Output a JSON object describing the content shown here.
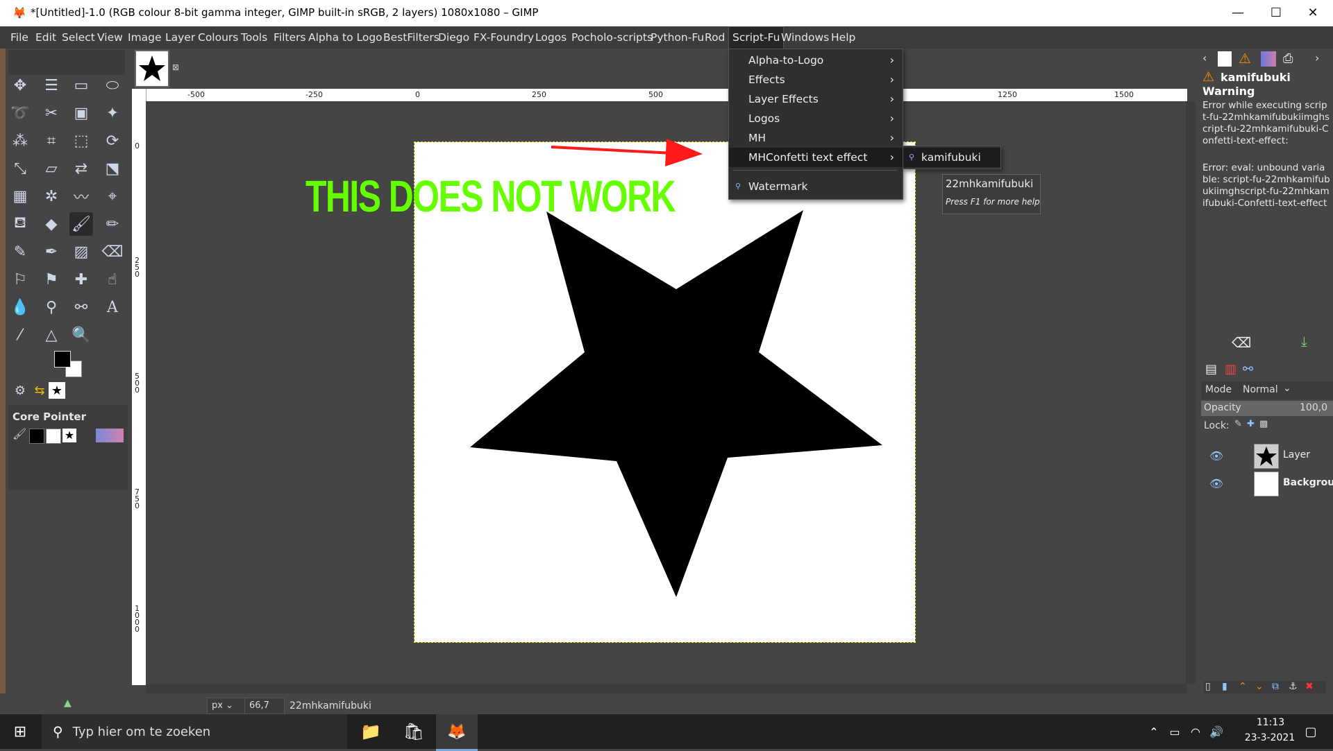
{
  "window": {
    "title": "*[Untitled]-1.0 (RGB colour 8-bit gamma integer, GIMP built-in sRGB, 2 layers) 1080x1080 – GIMP",
    "minimize": "—",
    "maximize": "☐",
    "close": "✕"
  },
  "menubar": [
    "File",
    "Edit",
    "Select",
    "View",
    "Image",
    "Layer",
    "Colours",
    "Tools",
    "Filters",
    "Alpha to Logo",
    "BestFilters",
    "Diego",
    "FX-Foundry",
    "Logos",
    "Pocholo-scripts",
    "Python-Fu",
    "Rod",
    "Script-Fu",
    "Windows",
    "Help"
  ],
  "scriptfu_menu": {
    "items": [
      "Alpha-to-Logo",
      "Effects",
      "Layer Effects",
      "Logos",
      "MH",
      "MHConfetti text effect"
    ],
    "watermark": "Watermark"
  },
  "submenu": {
    "item": "kamifubuki"
  },
  "tooltip": {
    "title": "22mhkamifubuki",
    "hint": "Press F1 for more help"
  },
  "overlay_text": "THIS DOES NOT WORK",
  "ruler": {
    "h": [
      "-500",
      "-250",
      "0",
      "250",
      "500",
      "1250",
      "1500"
    ],
    "v": [
      "0",
      "2\n5\n0",
      "5\n0\n0",
      "7\n5\n0",
      "1\n0\n0\n0"
    ]
  },
  "toolbox": {
    "core_pointer": "Core Pointer"
  },
  "statusbar": {
    "unit": "px",
    "zoom": "66,7 %",
    "message": "22mhkamifubuki"
  },
  "error_panel": {
    "name": "kamifubuki",
    "heading": "Warning",
    "line1": "Error while executing script-fu-22mhkamifubukiimghscript-fu-22mhkamifubuki-Confetti-text-effect:",
    "line2": "Error: eval: unbound variable: script-fu-22mhkamifubukiimghscript-fu-22mhkamifubuki-Confetti-text-effect"
  },
  "layers": {
    "mode_label": "Mode",
    "mode_value": "Normal",
    "opacity_label": "Opacity",
    "opacity_value": "100,0",
    "lock_label": "Lock:",
    "items": [
      "Layer",
      "Background"
    ]
  },
  "taskbar": {
    "search": "Typ hier om te zoeken",
    "time": "11:13",
    "date": "23-3-2021"
  },
  "colors": {
    "overlay": "#66ff00",
    "arrow": "#ff1a1a",
    "warning": "#ff8c00"
  }
}
